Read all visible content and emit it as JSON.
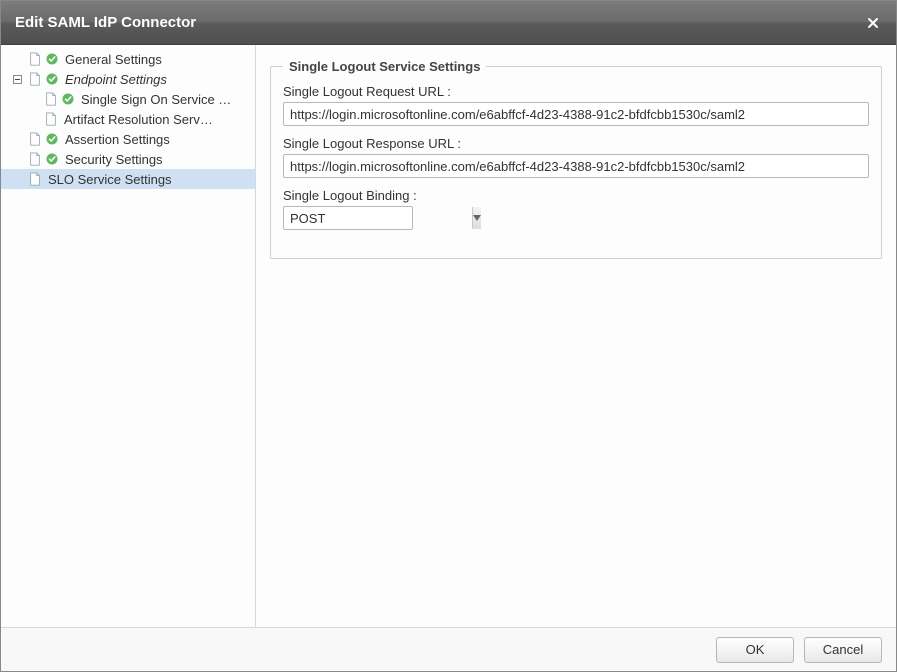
{
  "dialog": {
    "title": "Edit SAML IdP Connector"
  },
  "sidebar": {
    "items": [
      {
        "label": "General Settings"
      },
      {
        "label": "Endpoint Settings"
      },
      {
        "label": "Single Sign On Service …"
      },
      {
        "label": "Artifact Resolution Serv…"
      },
      {
        "label": "Assertion Settings"
      },
      {
        "label": "Security Settings"
      },
      {
        "label": "SLO Service Settings"
      }
    ]
  },
  "form": {
    "legend": "Single Logout Service Settings",
    "requestLabel": "Single Logout Request URL :",
    "requestValue": "https://login.microsoftonline.com/e6abffcf-4d23-4388-91c2-bfdfcbb1530c/saml2",
    "responseLabel": "Single Logout Response URL :",
    "responseValue": "https://login.microsoftonline.com/e6abffcf-4d23-4388-91c2-bfdfcbb1530c/saml2",
    "bindingLabel": "Single Logout Binding :",
    "bindingValue": "POST"
  },
  "footer": {
    "ok": "OK",
    "cancel": "Cancel"
  }
}
